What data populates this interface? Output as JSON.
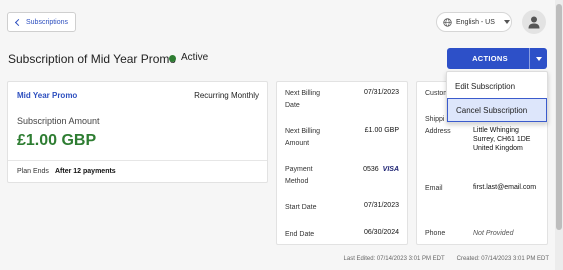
{
  "nav": {
    "back_label": "Subscriptions"
  },
  "header": {
    "language": "English - US",
    "title": "Subscription of Mid Year Promo",
    "status": "Active",
    "actions_label": "ACTIONS"
  },
  "actions_menu": {
    "items": [
      {
        "label": "Edit Subscription"
      },
      {
        "label": "Cancel Subscription"
      }
    ]
  },
  "plan": {
    "name": "Mid Year Promo",
    "frequency": "Recurring Monthly",
    "amount_label": "Subscription Amount",
    "amount": "£1.00 GBP",
    "ends_label": "Plan Ends",
    "ends_value": "After 12 payments"
  },
  "billing": {
    "next_date_label": "Next Billing Date",
    "next_date": "07/31/2023",
    "next_amount_label": "Next Billing Amount",
    "next_amount": "£1.00 GBP",
    "payment_label": "Payment Method",
    "card_last4": "0536",
    "card_brand": "VISA",
    "start_label": "Start Date",
    "start": "07/31/2023",
    "end_label": "End Date",
    "end": "06/30/2024"
  },
  "customer": {
    "header_label": "Custom",
    "shipping_label_1": "Shippi",
    "shipping_label_2": "Address",
    "address_line1": "Little Whinging",
    "address_line2": "Surrey, CH61 1DE",
    "address_line3": "United Kingdom",
    "email_label": "Email",
    "email": "first.last@email.com",
    "phone_label": "Phone",
    "phone": "Not Provided"
  },
  "footer": {
    "last_edited": "Last Edited: 07/14/2023 3:01 PM EDT",
    "created": "Created: 07/14/2023 3:01 PM EDT"
  },
  "colors": {
    "accent": "#2d50c8",
    "status_active": "#2e7d32",
    "amount": "#2e7d32"
  }
}
